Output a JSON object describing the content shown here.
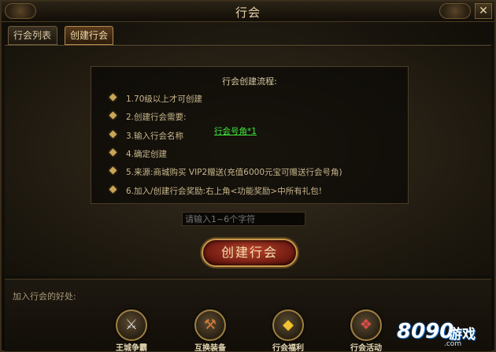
{
  "window": {
    "title": "行会",
    "close_label": "✕"
  },
  "tabs": [
    {
      "label": "行会列表",
      "active": false
    },
    {
      "label": "创建行会",
      "active": true
    }
  ],
  "info": {
    "title": "行会创建流程:",
    "steps": [
      "1.70级以上才可创建",
      "2.创建行会需要:",
      "3.输入行会名称",
      "4.确定创建",
      "5.来源:商城购买 VIP2赠送(充值6000元宝可赠送行会号角)",
      "6.加入/创建行会奖励:右上角<功能奖励>中所有礼包!"
    ],
    "requirement_link": "行会号角*1"
  },
  "name_input": {
    "placeholder": "请输入1~6个字符"
  },
  "create_button": {
    "label": "创建行会"
  },
  "benefits": {
    "heading": "加入行会的好处:",
    "items": [
      {
        "label": "王城争霸",
        "icon": "crossed-swords-icon"
      },
      {
        "label": "互换装备",
        "icon": "weapon-icon"
      },
      {
        "label": "行会福利",
        "icon": "gold-ingot-icon"
      },
      {
        "label": "行会活动",
        "icon": "treasure-pot-icon"
      }
    ]
  },
  "watermark": {
    "number": "8090",
    "text": "游戏",
    "domain": ".com"
  },
  "colors": {
    "accent": "#c79a4a",
    "link": "#3ee83a",
    "button": "#8a2416"
  }
}
